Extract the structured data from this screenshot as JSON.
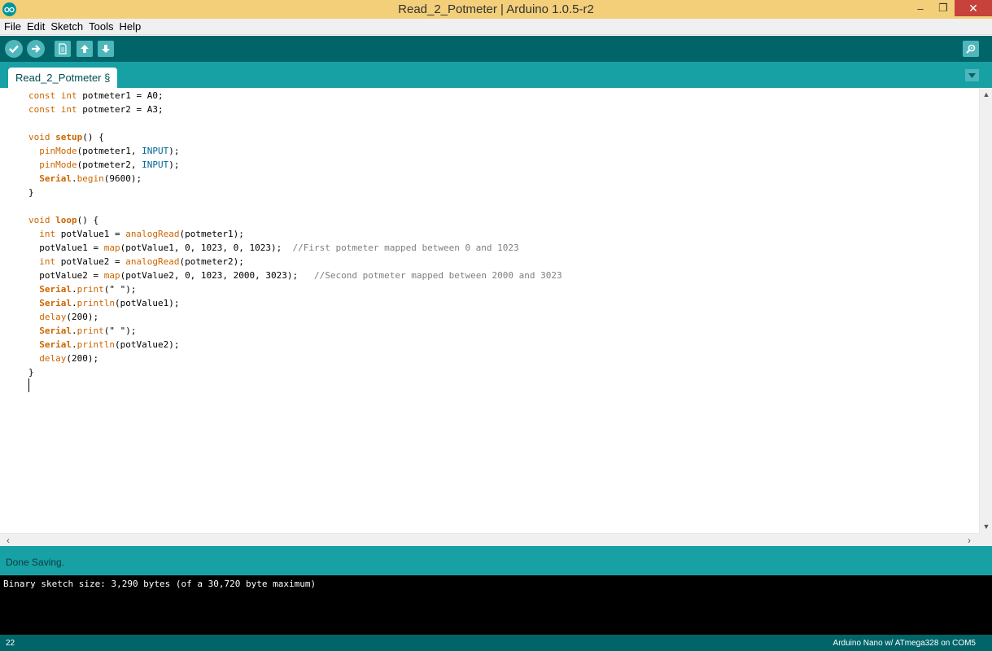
{
  "window": {
    "title": "Read_2_Potmeter | Arduino 1.0.5-r2",
    "controls": [
      "–",
      "❐",
      "✕"
    ]
  },
  "menu": [
    "File",
    "Edit",
    "Sketch",
    "Tools",
    "Help"
  ],
  "toolbar": {
    "buttons": [
      "verify-button",
      "upload-button",
      "new-button",
      "open-button",
      "save-button",
      "serial-monitor-button"
    ]
  },
  "tabs": [
    {
      "label": "Read_2_Potmeter §"
    }
  ],
  "editor": {
    "lines": [
      "const int potmeter1 = A0;",
      "const int potmeter2 = A3;",
      "",
      "void setup() {",
      "  pinMode(potmeter1, INPUT);",
      "  pinMode(potmeter2, INPUT);",
      "  Serial.begin(9600);",
      "}",
      "",
      "void loop() {",
      "  int potValue1 = analogRead(potmeter1);",
      "  potValue1 = map(potValue1, 0, 1023, 0, 1023);  //First potmeter mapped between 0 and 1023",
      "  int potValue2 = analogRead(potmeter2);",
      "  potValue2 = map(potValue2, 0, 1023, 2000, 3023);   //Second potmeter mapped between 2000 and 3023",
      "  Serial.print(\" \");",
      "  Serial.println(potValue1);",
      "  delay(200);",
      "  Serial.print(\" \");",
      "  Serial.println(potValue2);",
      "  delay(200);",
      "}",
      ""
    ]
  },
  "status": {
    "message": "Done Saving."
  },
  "console": {
    "output": "Binary sketch size: 3,290 bytes (of a 30,720 byte maximum)"
  },
  "footer": {
    "line_number": "22",
    "board": "Arduino Nano w/ ATmega328 on COM5"
  }
}
